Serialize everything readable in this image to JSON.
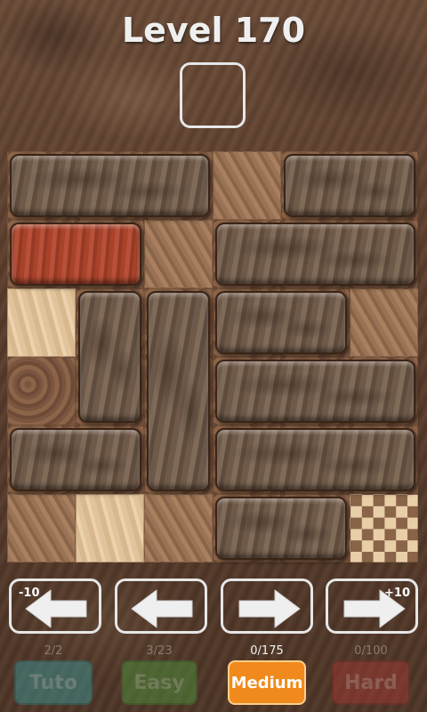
{
  "level": {
    "title": "Level 170"
  },
  "arrows": [
    {
      "name": "undo-10-button",
      "tag": "-10",
      "direction": "left"
    },
    {
      "name": "undo-button",
      "tag": "",
      "direction": "left"
    },
    {
      "name": "redo-button",
      "tag": "",
      "direction": "right"
    },
    {
      "name": "redo-10-button",
      "tag": "+10",
      "direction": "right"
    }
  ],
  "modes": [
    {
      "label": "Tuto",
      "count": "2/2",
      "color": "#3e8f8e",
      "active": false
    },
    {
      "label": "Easy",
      "count": "3/23",
      "color": "#4f8a3c",
      "active": false
    },
    {
      "label": "Medium",
      "count": "0/175",
      "color": "#f08a1c",
      "active": true
    },
    {
      "label": "Hard",
      "count": "0/100",
      "color": "#9c3a33",
      "active": false
    }
  ],
  "board": {
    "cols": 6,
    "rows": 6,
    "blocks": [
      {
        "col": 0,
        "row": 0,
        "w": 3,
        "h": 1,
        "kind": "wood"
      },
      {
        "col": 4,
        "row": 0,
        "w": 2,
        "h": 1,
        "kind": "wood"
      },
      {
        "col": 0,
        "row": 1,
        "w": 2,
        "h": 1,
        "kind": "red"
      },
      {
        "col": 3,
        "row": 1,
        "w": 3,
        "h": 1,
        "kind": "wood"
      },
      {
        "col": 1,
        "row": 2,
        "w": 1,
        "h": 2,
        "kind": "wood"
      },
      {
        "col": 2,
        "row": 2,
        "w": 1,
        "h": 3,
        "kind": "wood"
      },
      {
        "col": 3,
        "row": 2,
        "w": 2,
        "h": 1,
        "kind": "wood"
      },
      {
        "col": 3,
        "row": 3,
        "w": 3,
        "h": 1,
        "kind": "wood"
      },
      {
        "col": 0,
        "row": 4,
        "w": 2,
        "h": 1,
        "kind": "wood"
      },
      {
        "col": 3,
        "row": 4,
        "w": 3,
        "h": 1,
        "kind": "wood"
      },
      {
        "col": 3,
        "row": 5,
        "w": 2,
        "h": 1,
        "kind": "wood"
      }
    ],
    "tiles": [
      [
        "dark",
        "dark",
        "dark",
        "mid",
        "dark",
        "dark"
      ],
      [
        "dark",
        "dark",
        "mid",
        "dark",
        "dark",
        "dark"
      ],
      [
        "light",
        "dark",
        "dark",
        "dark",
        "dark",
        "mid"
      ],
      [
        "dark",
        "dark",
        "dark",
        "dark",
        "dark",
        "dark"
      ],
      [
        "dark",
        "dark",
        "dark",
        "dark",
        "dark",
        "dark"
      ],
      [
        "mid",
        "light",
        "mid",
        "dark",
        "dark",
        "checker"
      ]
    ]
  }
}
